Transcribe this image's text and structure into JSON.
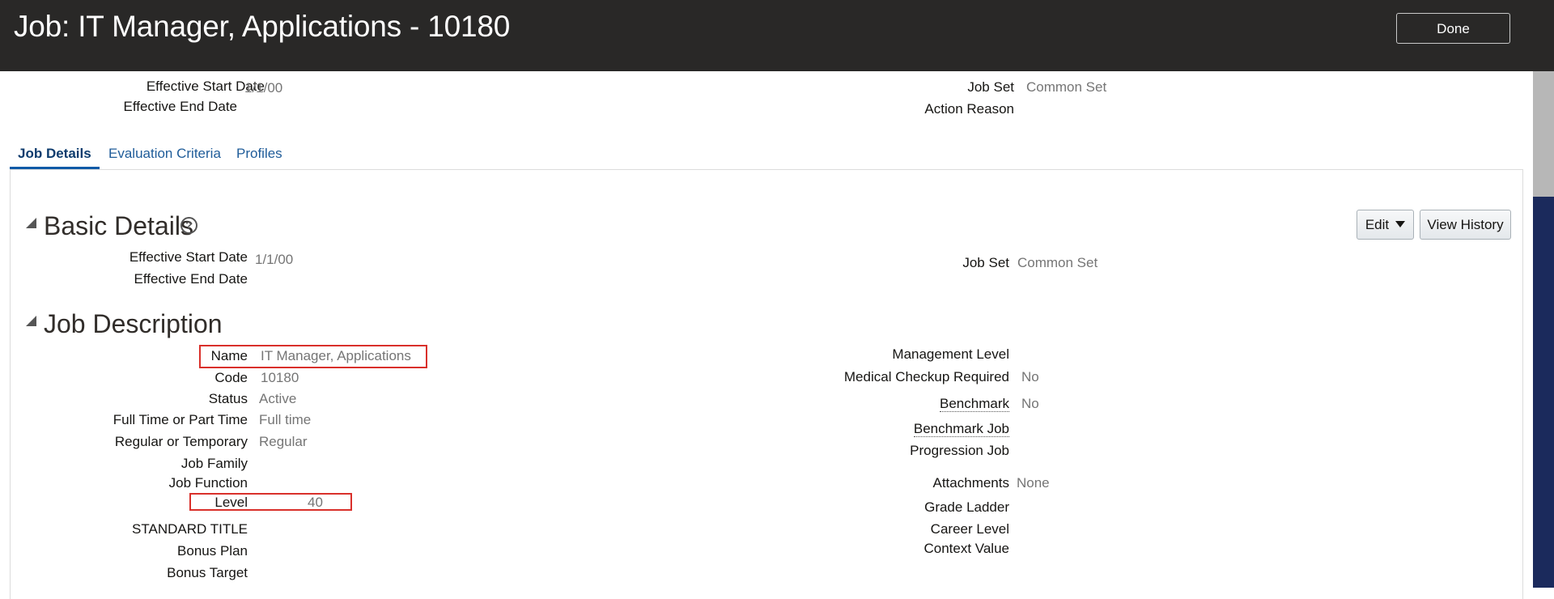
{
  "header": {
    "title": "Job: IT Manager, Applications - 10180",
    "done_label": "Done"
  },
  "top_summary": {
    "effective_start_label": "Effective Start Date",
    "effective_start_value": "1/1/00",
    "effective_end_label": "Effective End Date",
    "job_set_label": "Job Set",
    "job_set_value": "Common Set",
    "action_reason_label": "Action Reason"
  },
  "tabs": [
    {
      "label": "Job Details",
      "active": true
    },
    {
      "label": "Evaluation Criteria",
      "active": false
    },
    {
      "label": "Profiles",
      "active": false
    }
  ],
  "basic_details": {
    "title": "Basic Details",
    "help_glyph": "?",
    "edit_label": "Edit",
    "view_history_label": "View History",
    "effective_start_label": "Effective Start Date",
    "effective_start_value": "1/1/00",
    "effective_end_label": "Effective End Date",
    "job_set_label": "Job Set",
    "job_set_value": "Common Set"
  },
  "job_description": {
    "title": "Job Description",
    "left": [
      {
        "label": "Name",
        "value": "IT Manager, Applications"
      },
      {
        "label": "Code",
        "value": "10180"
      },
      {
        "label": "Status",
        "value": "Active"
      },
      {
        "label": "Full Time or Part Time",
        "value": "Full time"
      },
      {
        "label": "Regular or Temporary",
        "value": "Regular"
      },
      {
        "label": "Job Family",
        "value": ""
      },
      {
        "label": "Job Function",
        "value": ""
      },
      {
        "label": "Level",
        "value": "40"
      },
      {
        "label": "STANDARD TITLE",
        "value": ""
      },
      {
        "label": "Bonus Plan",
        "value": ""
      },
      {
        "label": "Bonus Target",
        "value": ""
      }
    ],
    "right": [
      {
        "label": "Management Level",
        "value": ""
      },
      {
        "label": "Medical Checkup Required",
        "value": "No"
      },
      {
        "label": "Benchmark",
        "value": "No"
      },
      {
        "label": "Benchmark Job",
        "value": ""
      },
      {
        "label": "Progression Job",
        "value": ""
      },
      {
        "label": "Attachments",
        "value": "None"
      },
      {
        "label": "Grade Ladder",
        "value": ""
      },
      {
        "label": "Career Level",
        "value": ""
      },
      {
        "label": "Context Value",
        "value": ""
      }
    ]
  },
  "colors": {
    "header_bg": "#292827",
    "link": "#1f5c99",
    "highlight_box": "#d9302b",
    "scroll_track": "#1b2a5c"
  }
}
